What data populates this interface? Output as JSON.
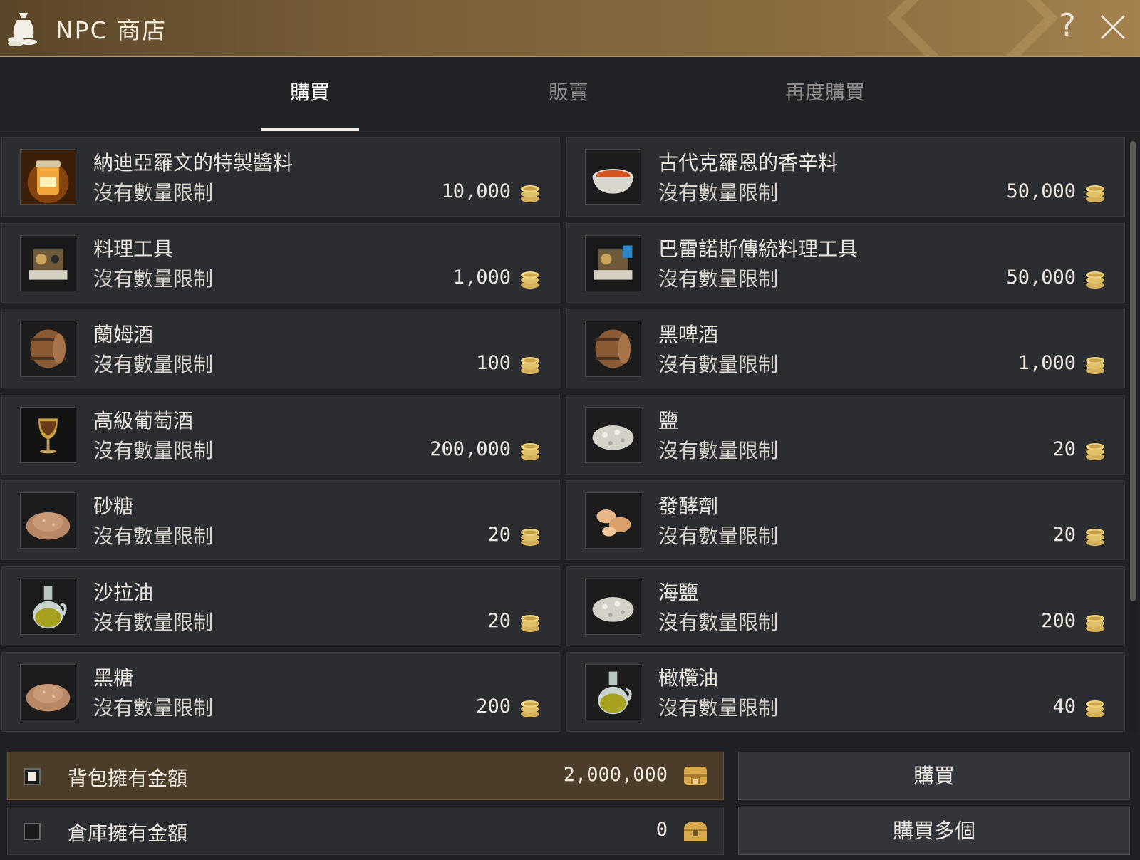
{
  "window": {
    "title": "NPC 商店",
    "help_label": "?"
  },
  "tabs": [
    {
      "label": "購買",
      "active": true
    },
    {
      "label": "販賣",
      "active": false
    },
    {
      "label": "再度購買",
      "active": false
    }
  ],
  "items": [
    {
      "name": "納迪亞羅文的特製醬料",
      "limit": "沒有數量限制",
      "price": "10,000",
      "icon": "sauce-jar-icon"
    },
    {
      "name": "古代克羅恩的香辛料",
      "limit": "沒有數量限制",
      "price": "50,000",
      "icon": "spice-bowl-icon"
    },
    {
      "name": "料理工具",
      "limit": "沒有數量限制",
      "price": "1,000",
      "icon": "cooking-utensil-icon"
    },
    {
      "name": "巴雷諾斯傳統料理工具",
      "limit": "沒有數量限制",
      "price": "50,000",
      "icon": "traditional-cooking-utensil-icon"
    },
    {
      "name": "蘭姆酒",
      "limit": "沒有數量限制",
      "price": "100",
      "icon": "barrel-icon"
    },
    {
      "name": "黑啤酒",
      "limit": "沒有數量限制",
      "price": "1,000",
      "icon": "barrel-icon"
    },
    {
      "name": "高級葡萄酒",
      "limit": "沒有數量限制",
      "price": "200,000",
      "icon": "wine-goblet-icon"
    },
    {
      "name": "鹽",
      "limit": "沒有數量限制",
      "price": "20",
      "icon": "salt-pile-icon"
    },
    {
      "name": "砂糖",
      "limit": "沒有數量限制",
      "price": "20",
      "icon": "sugar-pile-icon"
    },
    {
      "name": "發酵劑",
      "limit": "沒有數量限制",
      "price": "20",
      "icon": "leavening-icon"
    },
    {
      "name": "沙拉油",
      "limit": "沒有數量限制",
      "price": "20",
      "icon": "oil-flask-icon"
    },
    {
      "name": "海鹽",
      "limit": "沒有數量限制",
      "price": "200",
      "icon": "salt-pile-icon"
    },
    {
      "name": "黑糖",
      "limit": "沒有數量限制",
      "price": "200",
      "icon": "sugar-pile-icon"
    },
    {
      "name": "橄欖油",
      "limit": "沒有數量限制",
      "price": "40",
      "icon": "oil-flask-icon"
    }
  ],
  "money": {
    "bag_label": "背包擁有金額",
    "bag_value": "2,000,000",
    "bag_checked": true,
    "warehouse_label": "倉庫擁有金額",
    "warehouse_value": "0",
    "warehouse_checked": false
  },
  "buttons": {
    "buy": "購買",
    "buy_multiple": "購買多個"
  },
  "colors": {
    "titlebar": "#7a6038",
    "panel": "#2c2d31",
    "accent_gold": "#d4b15a"
  }
}
